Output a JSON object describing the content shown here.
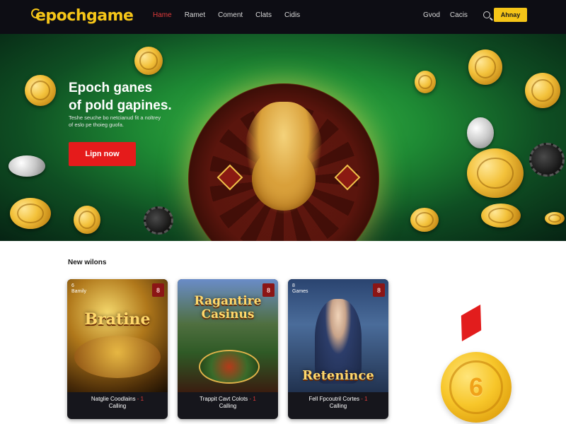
{
  "header": {
    "logo_prefix": "epoch",
    "logo_suffix": "game",
    "nav": [
      {
        "label": "Hame",
        "active": true
      },
      {
        "label": "Ramet",
        "active": false
      },
      {
        "label": "Coment",
        "active": false
      },
      {
        "label": "Clats",
        "active": false
      },
      {
        "label": "Cidis",
        "active": false
      }
    ],
    "right_links": [
      "Gvod",
      "Cacis"
    ],
    "cta_label": "Ahnay"
  },
  "hero": {
    "title_line1": "Epoch ganes",
    "title_line2": "of pold gapines.",
    "subtitle_line1": "Teshe seuche bo netcianud fit a noltrey",
    "subtitle_line2": "of eslo pe thoieg guofa.",
    "button_label": "Lipn now",
    "accent_color": "#e51b1b",
    "brand_color": "#f5c518"
  },
  "section": {
    "title": "New wilons"
  },
  "cards": [
    {
      "title": "Bratine",
      "badge": "8",
      "tag_line1": "6",
      "tag_line2": "Bamily",
      "caption_line1": "Natglie Coodlains",
      "caption_dash": "- 1",
      "caption_line2": "Calling"
    },
    {
      "title_line1": "Ragantire",
      "title_line2": "Casinus",
      "badge": "8",
      "tag_line1": "",
      "tag_line2": "",
      "caption_line1": "Trappit Cavt Colots",
      "caption_dash": "- 1",
      "caption_line2": "Calling"
    },
    {
      "title": "Retenince",
      "badge": "8",
      "tag_line1": "8",
      "tag_line2": "Games",
      "caption_line1": "Fell Fpcoutril Cortes",
      "caption_dash": "- 1",
      "caption_line2": "Calling"
    }
  ],
  "medal": {
    "number": "6",
    "ribbon_color": "#e21d1d",
    "medal_color": "#f7c62a"
  }
}
